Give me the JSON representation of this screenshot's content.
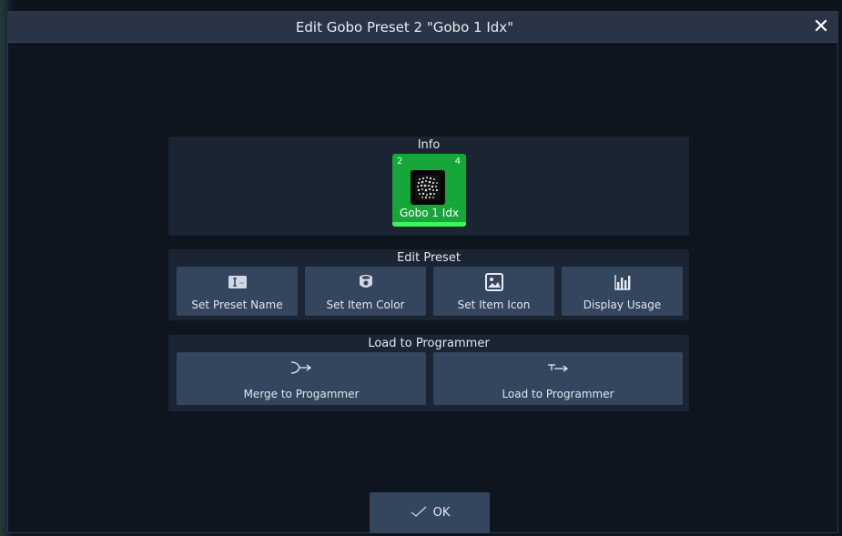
{
  "dialog": {
    "title": "Edit Gobo Preset 2 \"Gobo 1 Idx\"",
    "close_icon": "close-icon"
  },
  "info": {
    "heading": "Info",
    "preset": {
      "number": "2",
      "count": "4",
      "name": "Gobo 1 Idx",
      "color": "#16a63a",
      "icon": "gobo-pattern-icon"
    }
  },
  "edit_preset": {
    "heading": "Edit Preset",
    "buttons": [
      {
        "label": "Set Preset Name",
        "icon": "text-cursor-icon"
      },
      {
        "label": "Set Item Color",
        "icon": "color-cup-icon"
      },
      {
        "label": "Set Item Icon",
        "icon": "image-icon"
      },
      {
        "label": "Display Usage",
        "icon": "bar-chart-icon"
      }
    ]
  },
  "load_to_programmer": {
    "heading": "Load to Programmer",
    "buttons": [
      {
        "label": "Merge to Progammer",
        "icon": "merge-arrow-icon"
      },
      {
        "label": "Load to Programmer",
        "icon": "load-arrow-icon"
      }
    ]
  },
  "footer": {
    "ok_label": "OK",
    "ok_icon": "checkmark-icon"
  }
}
